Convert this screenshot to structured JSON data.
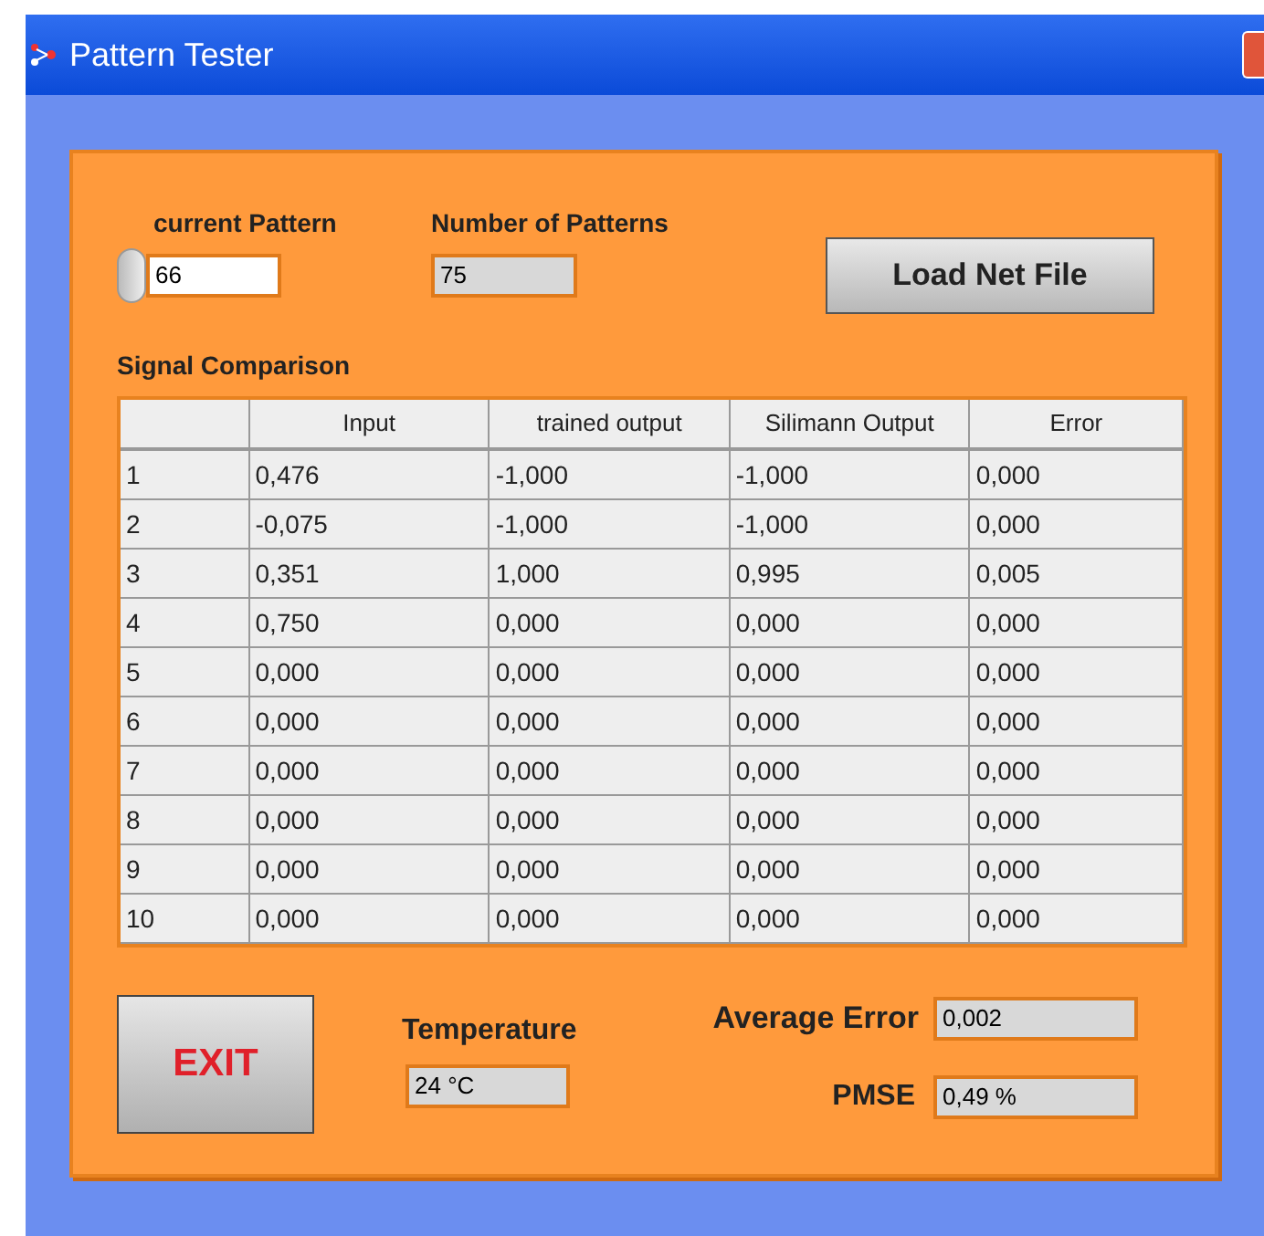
{
  "window": {
    "title": "Pattern Tester"
  },
  "current_pattern": {
    "label": "current Pattern",
    "value": "66"
  },
  "number_of_patterns": {
    "label": "Number of Patterns",
    "value": "75"
  },
  "load_button": "Load Net File",
  "table": {
    "title": "Signal Comparison",
    "columns": [
      "",
      "Input",
      "trained output",
      "Silimann Output",
      "Error"
    ],
    "rows": [
      [
        "1",
        "0,476",
        "-1,000",
        "-1,000",
        "0,000"
      ],
      [
        "2",
        "-0,075",
        "-1,000",
        "-1,000",
        "0,000"
      ],
      [
        "3",
        "0,351",
        "1,000",
        "0,995",
        "0,005"
      ],
      [
        "4",
        "0,750",
        "0,000",
        "0,000",
        "0,000"
      ],
      [
        "5",
        "0,000",
        "0,000",
        "0,000",
        "0,000"
      ],
      [
        "6",
        "0,000",
        "0,000",
        "0,000",
        "0,000"
      ],
      [
        "7",
        "0,000",
        "0,000",
        "0,000",
        "0,000"
      ],
      [
        "8",
        "0,000",
        "0,000",
        "0,000",
        "0,000"
      ],
      [
        "9",
        "0,000",
        "0,000",
        "0,000",
        "0,000"
      ],
      [
        "10",
        "0,000",
        "0,000",
        "0,000",
        "0,000"
      ]
    ]
  },
  "exit_button": "EXIT",
  "temperature": {
    "label": "Temperature",
    "value": "24 °C"
  },
  "average_error": {
    "label": "Average Error",
    "value": "0,002"
  },
  "pmse": {
    "label": "PMSE",
    "value": "0,49 %"
  }
}
